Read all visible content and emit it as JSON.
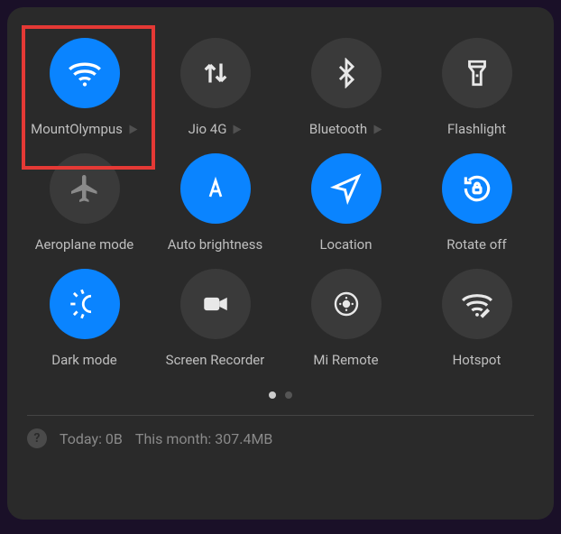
{
  "tiles": [
    {
      "id": "wifi",
      "label": "MountOlympus",
      "icon": "wifi-icon",
      "active": true,
      "expandable": true
    },
    {
      "id": "mobile-data",
      "label": "Jio 4G",
      "icon": "data-arrows-icon",
      "active": false,
      "expandable": true
    },
    {
      "id": "bluetooth",
      "label": "Bluetooth",
      "icon": "bluetooth-icon",
      "active": false,
      "expandable": true
    },
    {
      "id": "flashlight",
      "label": "Flashlight",
      "icon": "flashlight-icon",
      "active": false,
      "expandable": false
    },
    {
      "id": "aeroplane",
      "label": "Aeroplane mode",
      "icon": "airplane-icon",
      "active": false,
      "expandable": false
    },
    {
      "id": "auto-brightness",
      "label": "Auto brightness",
      "icon": "auto-brightness-icon",
      "active": true,
      "expandable": false
    },
    {
      "id": "location",
      "label": "Location",
      "icon": "location-icon",
      "active": true,
      "expandable": false
    },
    {
      "id": "rotate",
      "label": "Rotate off",
      "icon": "rotate-lock-icon",
      "active": true,
      "expandable": false
    },
    {
      "id": "dark-mode",
      "label": "Dark mode",
      "icon": "dark-mode-icon",
      "active": true,
      "expandable": false
    },
    {
      "id": "screen-recorder",
      "label": "Screen Recorder",
      "icon": "video-camera-icon",
      "active": false,
      "expandable": false
    },
    {
      "id": "mi-remote",
      "label": "Mi Remote",
      "icon": "remote-icon",
      "active": false,
      "expandable": false
    },
    {
      "id": "hotspot",
      "label": "Hotspot",
      "icon": "hotspot-icon",
      "active": false,
      "expandable": false
    }
  ],
  "pagination": {
    "pages": 2,
    "active": 0
  },
  "data_usage": {
    "today_label": "Today:",
    "today_value": "0B",
    "month_label": "This month:",
    "month_value": "307.4MB"
  },
  "highlight": {
    "tile_index": 0
  },
  "colors": {
    "active": "#0a84ff",
    "inactive": "#3a3a3a",
    "panel": "#2a2a2a",
    "highlight": "#e53935"
  }
}
